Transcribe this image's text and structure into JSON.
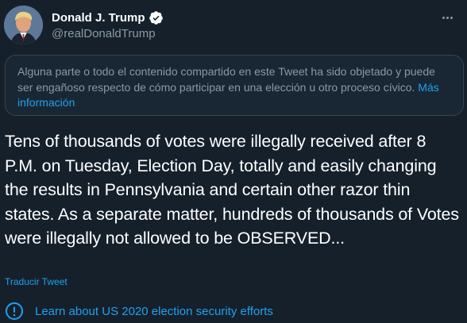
{
  "author": {
    "display_name": "Donald J. Trump",
    "handle": "@realDonaldTrump",
    "verified_icon": "verified-badge-icon",
    "avatar_icon": "profile-photo"
  },
  "menu_icon": "more-horizontal-icon",
  "warning": {
    "text": "Alguna parte o todo el contenido compartido en este Tweet ha sido objetado y puede ser engañoso respecto de cómo participar en una elección u otro proceso cívico. ",
    "link_label": "Más información"
  },
  "tweet": {
    "text": "Tens of thousands of votes were illegally received after 8 P.M. on Tuesday, Election Day, totally and easily changing the results in Pennsylvania and certain other razor thin states. As a separate matter, hundreds of thousands of Votes were illegally not allowed to be OBSERVED..."
  },
  "translate_label": "Traducir Tweet",
  "election_notice": {
    "label": "Learn about US 2020 election security efforts",
    "icon": "info-circle-icon"
  },
  "colors": {
    "background": "#15202b",
    "accent": "#1da1f2",
    "secondary_text": "#8899a6",
    "border": "#38444d"
  }
}
